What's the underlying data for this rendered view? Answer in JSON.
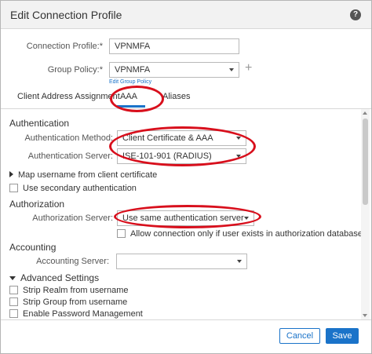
{
  "dialog": {
    "title": "Edit Connection Profile",
    "help_icon": "?"
  },
  "form": {
    "connection_profile_label": "Connection Profile:*",
    "connection_profile_value": "VPNMFA",
    "group_policy_label": "Group Policy:*",
    "group_policy_value": "VPNMFA",
    "plus_icon": "+",
    "edit_group_policy_link": "Edit Group Policy"
  },
  "tabs": [
    {
      "label": "Client Address Assignment",
      "active": false
    },
    {
      "label": "AAA",
      "active": true
    },
    {
      "label": "Aliases",
      "active": false
    }
  ],
  "authentication": {
    "title": "Authentication",
    "method_label": "Authentication Method:",
    "method_value": "Client Certificate & AAA",
    "server_label": "Authentication Server:",
    "server_value": "ISE-101-901 (RADIUS)",
    "map_username_label": "Map username from client certificate",
    "secondary_auth_label": "Use secondary authentication"
  },
  "authorization": {
    "title": "Authorization",
    "server_label": "Authorization Server:",
    "server_value": "Use same authentication server",
    "allow_label": "Allow connection only if user exists in authorization database"
  },
  "accounting": {
    "title": "Accounting",
    "server_label": "Accounting Server:",
    "server_value": ""
  },
  "advanced": {
    "title": "Advanced Settings",
    "strip_realm_label": "Strip Realm from username",
    "strip_group_label": "Strip Group from username",
    "password_mgmt_label": "Enable Password Management"
  },
  "footer": {
    "cancel_label": "Cancel",
    "save_label": "Save"
  },
  "colors": {
    "accent": "#1a73c9",
    "annotation": "#d80f1c",
    "titlebar": "#f2f2f2"
  }
}
